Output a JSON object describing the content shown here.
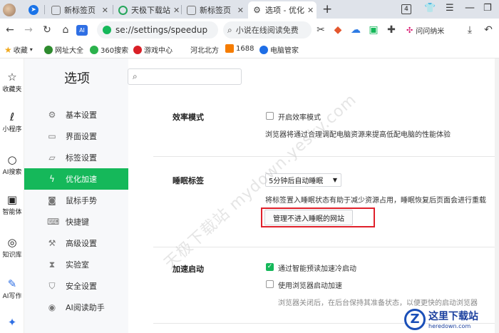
{
  "tabs": [
    {
      "label": "",
      "type": "avatar"
    },
    {
      "label": "",
      "type": "pinned"
    },
    {
      "label": "新标签页",
      "close": "✕"
    },
    {
      "label": "天极下载站",
      "close": "✕"
    },
    {
      "label": "新标签页",
      "close": "✕"
    },
    {
      "label": "选项 - 优化",
      "close": "✕",
      "active": true
    }
  ],
  "tabbar_right": {
    "new_tab": "+",
    "tab_count": "4"
  },
  "toolbar": {
    "ai_badge": "AI",
    "url": "se://settings/speedup",
    "search_text": "小说在线阅读免费",
    "profile_label": "问问纳米"
  },
  "bookmarks": [
    {
      "label": "收藏",
      "icon": "star-icon",
      "color": "#f0a81c"
    },
    {
      "label": "网址大全",
      "icon": "web-icon",
      "color": "#2e8b2e"
    },
    {
      "label": "360搜索",
      "icon": "search360-icon",
      "color": "#2bb24c"
    },
    {
      "label": "游戏中心",
      "icon": "game-icon",
      "color": "#d91f26"
    },
    {
      "label": "河北北方",
      "icon": "",
      "color": ""
    },
    {
      "label": "1688",
      "icon": "1688-icon",
      "color": "#f57c00"
    },
    {
      "label": "电脑管家",
      "icon": "shield-icon",
      "color": "#1e6ee6"
    }
  ],
  "rail": [
    {
      "label": "收藏夹",
      "icon": "☆"
    },
    {
      "label": "小程序",
      "icon": "ℓ"
    },
    {
      "label": "AI搜索",
      "icon": "○"
    },
    {
      "label": "智能体",
      "icon": "▣"
    },
    {
      "label": "知识库",
      "icon": "◎"
    },
    {
      "label": "AI写作",
      "icon": "✎"
    },
    {
      "label": "",
      "icon": "✦"
    }
  ],
  "nav": {
    "title": "选项",
    "items": [
      {
        "label": "基本设置",
        "icon": "⚙"
      },
      {
        "label": "界面设置",
        "icon": "▭"
      },
      {
        "label": "标签设置",
        "icon": "▱"
      },
      {
        "label": "优化加速",
        "icon": "ϟ",
        "active": true
      },
      {
        "label": "鼠标手势",
        "icon": "◙"
      },
      {
        "label": "快捷键",
        "icon": "⌨"
      },
      {
        "label": "高级设置",
        "icon": "⚒"
      },
      {
        "label": "实验室",
        "icon": "⧗"
      },
      {
        "label": "安全设置",
        "icon": "⛉"
      },
      {
        "label": "AI阅读助手",
        "icon": "◉"
      }
    ]
  },
  "content": {
    "efficiency": {
      "title": "效率模式",
      "checkbox_label": "开启效率模式",
      "checked": false,
      "desc": "浏览器将通过合理调配电脑资源来提高低配电脑的性能体验"
    },
    "sleep": {
      "title": "睡眠标签",
      "select_value": "5分钟后自动睡眠",
      "desc": "将标签置入睡眠状态有助于减少资源占用，睡眠恢复后页面会进行重载",
      "button": "管理不进入睡眠的网站"
    },
    "boost": {
      "title": "加速启动",
      "opt1_label": "通过智能预读加速冷启动",
      "opt1_checked": true,
      "opt2_label": "使用浏览器启动加速",
      "opt2_checked": false,
      "desc": "浏览器关闭后，在后台保持其准备状态，以便更快的启动浏览器"
    }
  },
  "watermark": "天极下载站 mydown.yesky.com",
  "logo": {
    "title": "这里下载站",
    "subtitle": "heredown.com",
    "letter": "Z"
  },
  "colors": {
    "accent": "#15b85a",
    "highlight_box": "#e0202a"
  }
}
